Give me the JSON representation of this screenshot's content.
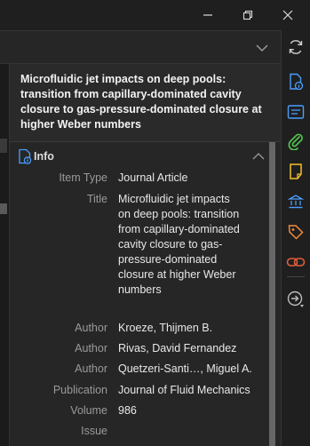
{
  "window": {
    "minimize_icon": "minimize-icon",
    "maximize_icon": "restore-icon",
    "close_icon": "close-icon"
  },
  "header": {
    "title": "Microfluidic jet impacts on deep pools: transition from capillary-dominated cavity closure to gas-pressure-dominated closure at higher Weber numbers"
  },
  "info_section": {
    "label": "Info",
    "icon": "document-icon",
    "fields": [
      {
        "key": "Item Type",
        "value": "Journal Article"
      },
      {
        "key": "Title",
        "value": "Microfluidic jet impacts on deep pools: transition from capillary-dominated cavity closure to gas-pressure-dominated closure at higher Weber numbers"
      },
      {
        "key": "Author",
        "value": "Kroeze, Thijmen B."
      },
      {
        "key": "Author",
        "value": "Rivas, David Fernandez"
      },
      {
        "key": "Author",
        "value": "Quetzeri-Santi…, Miguel A."
      },
      {
        "key": "Publication",
        "value": "Journal of Fluid Mechanics"
      },
      {
        "key": "Volume",
        "value": "986"
      },
      {
        "key": "Issue",
        "value": ""
      }
    ]
  },
  "sidebar": {
    "items": [
      "sync-icon",
      "info-document-icon",
      "abstract-icon",
      "attachments-icon",
      "notes-icon",
      "libraries-collections-icon",
      "tags-icon",
      "related-icon",
      "locate-icon"
    ]
  },
  "colors": {
    "accent_blue": "#4a9eff",
    "green": "#53c64f",
    "yellow": "#f5c02a",
    "orange": "#f08a3c",
    "background": "#262626"
  }
}
